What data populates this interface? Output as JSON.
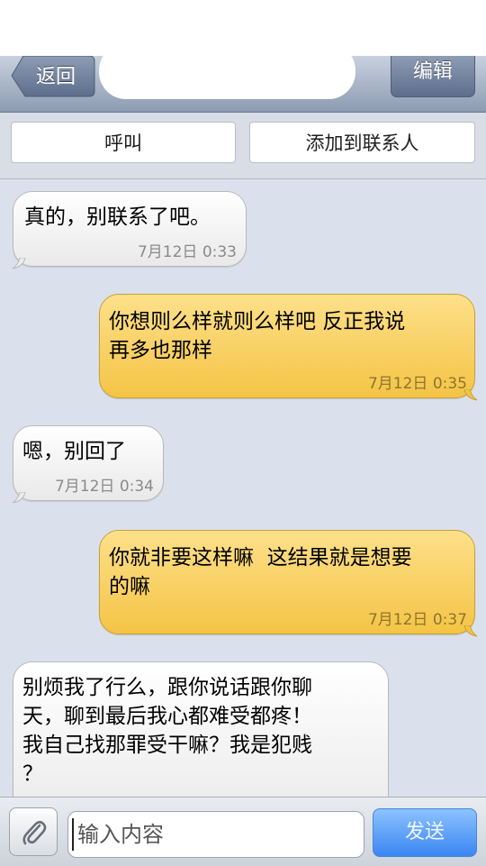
{
  "nav": {
    "back_label": "返回",
    "edit_label": "编辑"
  },
  "actions": {
    "call_label": "呼叫",
    "add_contact_label": "添加到联系人"
  },
  "messages": [
    {
      "direction": "incoming",
      "text": "真的，别联系了吧。",
      "time": "7月12日 0:33"
    },
    {
      "direction": "outgoing",
      "text": "你想则么样就则么样吧 反正我说\n再多也那样",
      "time": "7月12日 0:35"
    },
    {
      "direction": "incoming",
      "text": "嗯，别回了",
      "time": "7月12日 0:34"
    },
    {
      "direction": "outgoing",
      "text": "你就非要这样嘛  这结果就是想要\n的嘛",
      "time": "7月12日 0:37"
    },
    {
      "direction": "incoming",
      "text": "别烦我了行么，跟你说话跟你聊\n天，聊到最后我心都难受都疼！\n我自己找那罪受干嘛？我是犯贱\n？",
      "time": ""
    }
  ],
  "composer": {
    "placeholder": "输入内容",
    "value": "",
    "send_label": "发送"
  },
  "colors": {
    "incoming_bubble": "#f2f2f2",
    "outgoing_bubble": "#f8cf5a",
    "send_button": "#3a86f2",
    "navbar": "#8c9bb2"
  },
  "icons": {
    "attach": "paperclip-icon",
    "back": "back-arrow-icon"
  }
}
